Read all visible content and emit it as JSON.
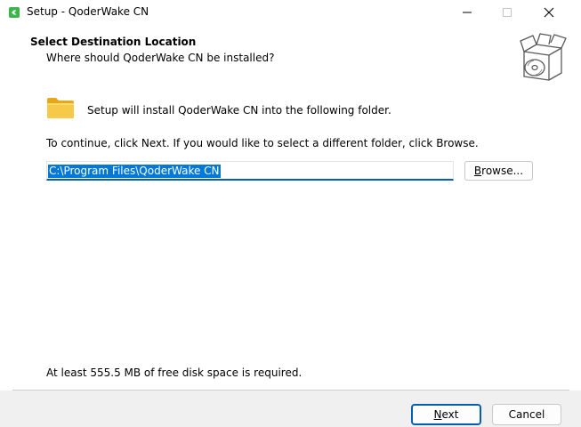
{
  "window": {
    "title": "Setup - QoderWake CN"
  },
  "header": {
    "title": "Select Destination Location",
    "subtitle": "Where should QoderWake CN be installed?"
  },
  "body": {
    "install_text": "Setup will install QoderWake CN into the following folder.",
    "continue_text": "To continue, click Next. If you would like to select a different folder, click Browse.",
    "path_value": "C:\\Program Files\\QoderWake CN",
    "browse_label": {
      "accel": "B",
      "rest": "rowse..."
    },
    "disk_space_text": "At least 555.5 MB of free disk space is required."
  },
  "footer": {
    "next_label": {
      "accel": "N",
      "rest": "ext"
    },
    "cancel_label": "Cancel"
  },
  "icons": {
    "app": "setup-app-icon",
    "folder": "folder-icon",
    "wizard": "box-with-disc-icon",
    "minimize": "minimize-icon",
    "maximize": "maximize-icon",
    "close": "close-icon"
  },
  "colors": {
    "accent": "#005fb8",
    "selection": "#0078d7",
    "footer_bg": "#f0f0f0",
    "folder": "#f5c242"
  }
}
